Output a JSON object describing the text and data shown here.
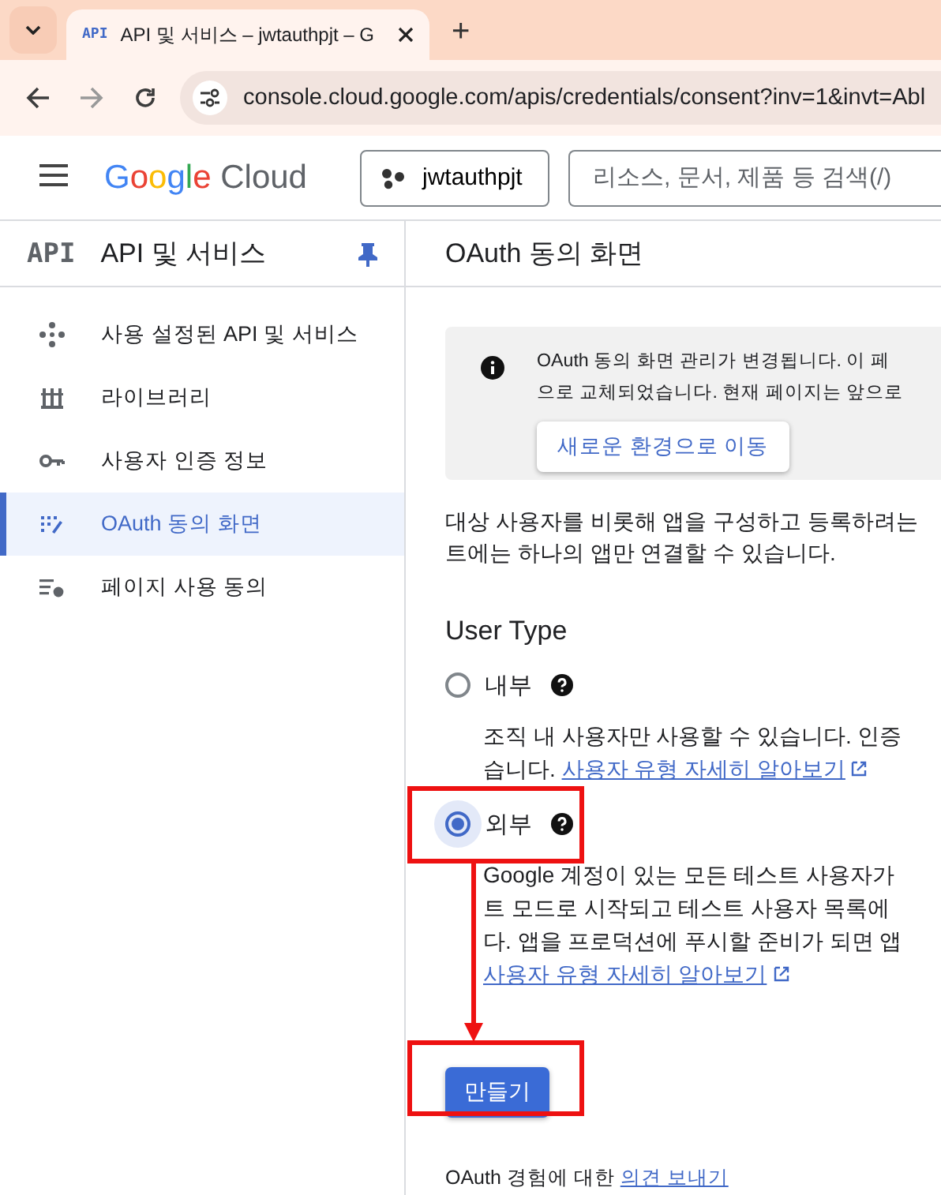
{
  "browser": {
    "tab_icon": "API",
    "tab_title": "API 및 서비스 – jwtauthpjt – G",
    "new_tab": "+",
    "url": "console.cloud.google.com/apis/credentials/consent?inv=1&invt=Abl"
  },
  "header": {
    "logo_word": "Google",
    "logo_product": "Cloud",
    "project": "jwtauthpjt",
    "search_placeholder": "리소스, 문서, 제품 등 검색(/)"
  },
  "sidebar": {
    "logo": "API",
    "title": "API 및 서비스",
    "pinned": true,
    "items": [
      {
        "label": "사용 설정된 API 및 서비스",
        "kind": "dots",
        "selected": false
      },
      {
        "label": "라이브러리",
        "kind": "library",
        "selected": false
      },
      {
        "label": "사용자 인증 정보",
        "kind": "key",
        "selected": false
      },
      {
        "label": "OAuth 동의 화면",
        "kind": "consent",
        "selected": true
      },
      {
        "label": "페이지 사용 동의",
        "kind": "settings-list",
        "selected": false
      }
    ]
  },
  "page": {
    "title": "OAuth 동의 화면",
    "notice": {
      "lines": [
        "OAuth 동의 화면 관리가 변경됩니다. 이 페",
        "으로 교체되었습니다. 현재 페이지는 앞으로"
      ],
      "button": "새로운 환경으로 이동"
    },
    "intro_lines": [
      "대상 사용자를 비롯해 앱을 구성하고 등록하려는",
      "트에는 하나의 앱만 연결할 수 있습니다."
    ],
    "user_type": {
      "heading": "User Type",
      "options": [
        {
          "label": "내부",
          "selected": false,
          "desc_lines": [
            "조직 내 사용자만 사용할 수 있습니다. 인증",
            "습니다."
          ],
          "link": "사용자 유형 자세히 알아보기",
          "link_wrapped": false
        },
        {
          "label": "외부",
          "selected": true,
          "desc_lines": [
            "Google 계정이 있는 모든 테스트 사용자가",
            "트 모드로 시작되고 테스트 사용자 목록에",
            "다. 앱을 프로덕션에 푸시할 준비가 되면 앱"
          ],
          "link": "사용자 유형 자세히 알아보기",
          "link_wrapped": true
        }
      ]
    },
    "create_button": "만들기",
    "feedback": {
      "text": "OAuth 경험에 대한",
      "link": "의견 보내기"
    }
  }
}
